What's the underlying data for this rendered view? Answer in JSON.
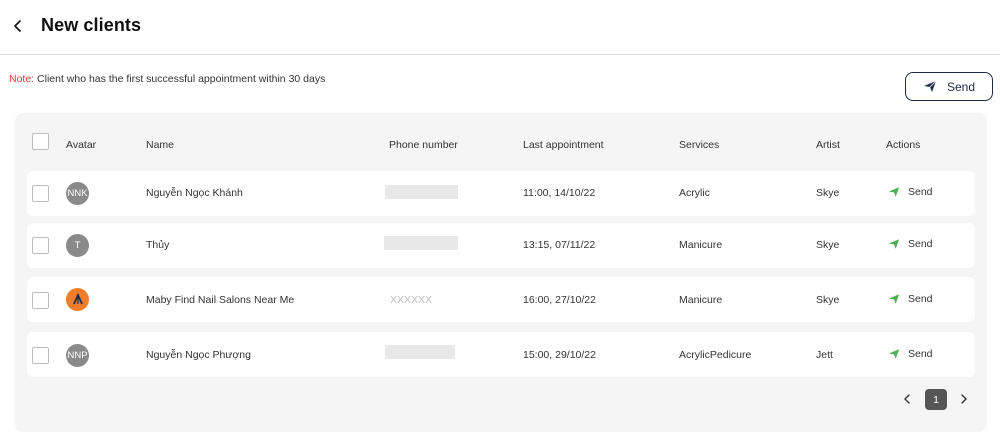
{
  "header": {
    "title": "New clients"
  },
  "note": {
    "label": "Note:",
    "text": " Client who has the first successful appointment within 30 days"
  },
  "toolbar": {
    "send_label": "Send"
  },
  "table": {
    "columns": [
      "Avatar",
      "Name",
      "Phone number",
      "Last appointment",
      "Services",
      "Artist",
      "Actions"
    ],
    "rows": [
      {
        "avatar": "NNK",
        "name": "Nguyễn Ngọc Khánh",
        "phone": "",
        "last_appointment": "11:00, 14/10/22",
        "services": "Acrylic",
        "artist": "Skye",
        "action": "Send"
      },
      {
        "avatar": "T",
        "name": "Thủy",
        "phone": "",
        "last_appointment": "13:15, 07/11/22",
        "services": "Manicure",
        "artist": "Skye",
        "action": "Send"
      },
      {
        "avatar": "",
        "name": "Maby Find Nail Salons Near Me",
        "phone": "XXXXXX",
        "last_appointment": "16:00, 27/10/22",
        "services": "Manicure",
        "artist": "Skye",
        "action": "Send"
      },
      {
        "avatar": "NNP",
        "name": "Nguyễn Ngọc Phượng",
        "phone": "",
        "last_appointment": "15:00, 29/10/22",
        "services": "AcrylicPedicure",
        "artist": "Jett",
        "action": "Send"
      }
    ]
  },
  "pagination": {
    "current": "1"
  },
  "colors": {
    "accent": "#1e2a4a",
    "note_label": "#e53935",
    "send_icon": "#4caf50",
    "page_active": "#555555"
  },
  "icons": {
    "back": "chevron-left-icon",
    "send": "paper-plane-icon",
    "prev": "chevron-left-icon",
    "next": "chevron-right-icon"
  }
}
